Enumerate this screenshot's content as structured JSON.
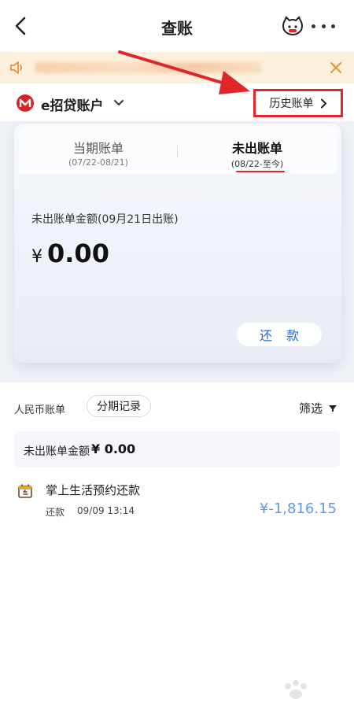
{
  "header": {
    "title": "查账"
  },
  "account": {
    "name": "e招贷账户",
    "history_label": "历史账单"
  },
  "tabs": [
    {
      "label": "当期账单",
      "range": "(07/22-08/21)",
      "active": false
    },
    {
      "label": "未出账单",
      "range": "(08/22-至今)",
      "active": true
    }
  ],
  "bill": {
    "caption": "未出账单金额(09月21日出账)",
    "currency": "¥",
    "amount": "0.00",
    "repay_label": "还款"
  },
  "list": {
    "currency_label": "人民币账单",
    "installments_label": "分期记录",
    "filter_label": "筛选",
    "summary_label": "未出账单金额",
    "summary_amount": "¥ 0.00"
  },
  "transactions": [
    {
      "title": "掌上生活预约还款",
      "type": "还款",
      "time": "09/09 13:14",
      "amount": "¥-1,816.15"
    }
  ],
  "colors": {
    "accent_red": "#e0262b",
    "accent_blue": "#1f6fd6",
    "amount_blue": "#5f9ae8",
    "notice_bg": "#fbf0dc"
  }
}
